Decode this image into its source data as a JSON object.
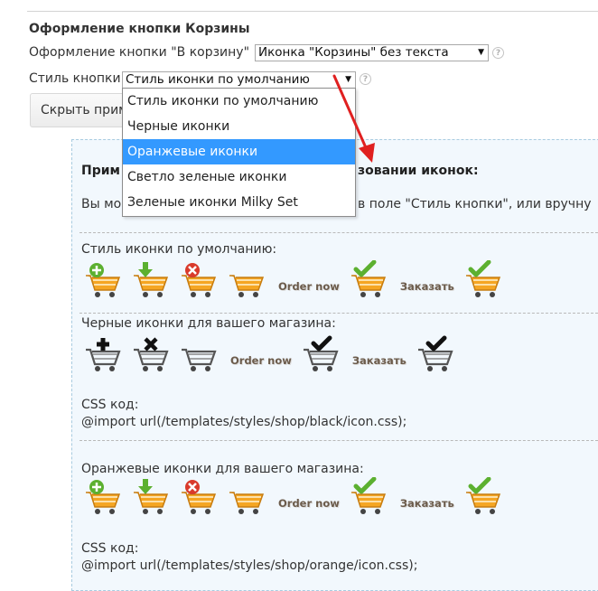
{
  "section": {
    "title": "Оформление кнопки Корзины"
  },
  "basket_button": {
    "label": "Оформление кнопки \"В корзину\"",
    "value": "Иконка \"Корзины\" без текста"
  },
  "button_style": {
    "label": "Стиль кнопки",
    "value": "Стиль иконки по умолчанию",
    "options": [
      "Стиль иконки по умолчанию",
      "Черные иконки",
      "Оранжевые иконки",
      "Светло зеленые иконки",
      "Зеленые иконки Milky Set"
    ],
    "highlighted_index": 2
  },
  "hide_button": {
    "label": "Скрыть прим"
  },
  "help_icon_text": "?",
  "panel": {
    "heading_left": "Прим",
    "heading_right": "зовании иконок:",
    "intro_left": "Вы мо",
    "intro_right": "в поле \"Стиль кнопки\", или вручну",
    "default_title": "Стиль иконки по умолчанию:",
    "black_title": "Черные иконки для вашего магазина:",
    "black_css_label": "CSS код:",
    "black_css": "@import url(/templates/styles/shop/black/icon.css);",
    "orange_title": "Оранжевые иконки для вашего магазина:",
    "orange_css_label": "CSS код:",
    "orange_css": "@import url(/templates/styles/shop/orange/icon.css);"
  },
  "icon_text": {
    "order_now": "Order now",
    "zakazat": "Заказать"
  },
  "colors": {
    "highlight": "#3399ff",
    "arrow": "#e02020",
    "panel_bg": "#f2f8fd",
    "panel_border": "#a8cbe0",
    "cart_orange": "#f5a623",
    "cart_black": "#555555",
    "badge_green": "#5cb030",
    "badge_red": "#d93a2b"
  }
}
